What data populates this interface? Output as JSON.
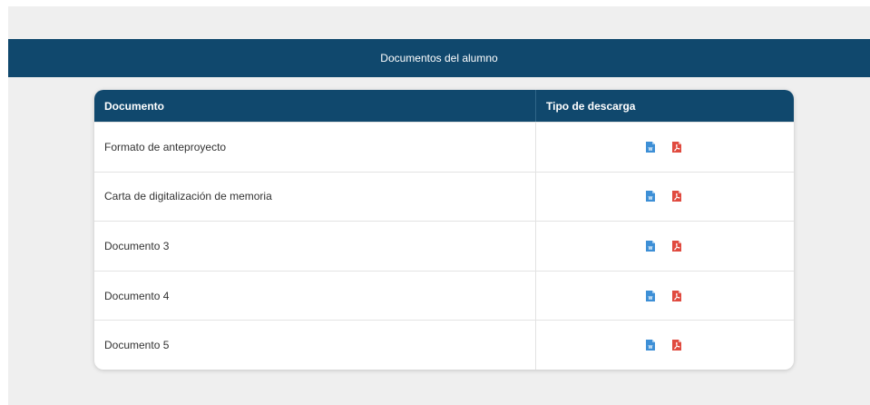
{
  "header": {
    "title": "Documentos del alumno"
  },
  "table": {
    "columns": [
      "Documento",
      "Tipo de descarga"
    ],
    "rows": [
      {
        "name": "Formato de anteproyecto"
      },
      {
        "name": "Carta de digitalización de memoria"
      },
      {
        "name": "Documento 3"
      },
      {
        "name": "Documento 4"
      },
      {
        "name": "Documento 5"
      }
    ]
  },
  "icons": {
    "word": "word-file-icon",
    "pdf": "pdf-file-icon"
  },
  "colors": {
    "header_bg": "#10486d",
    "page_bg": "#efefef",
    "word_icon": "#3d8fd6",
    "pdf_icon": "#e04a3f"
  }
}
